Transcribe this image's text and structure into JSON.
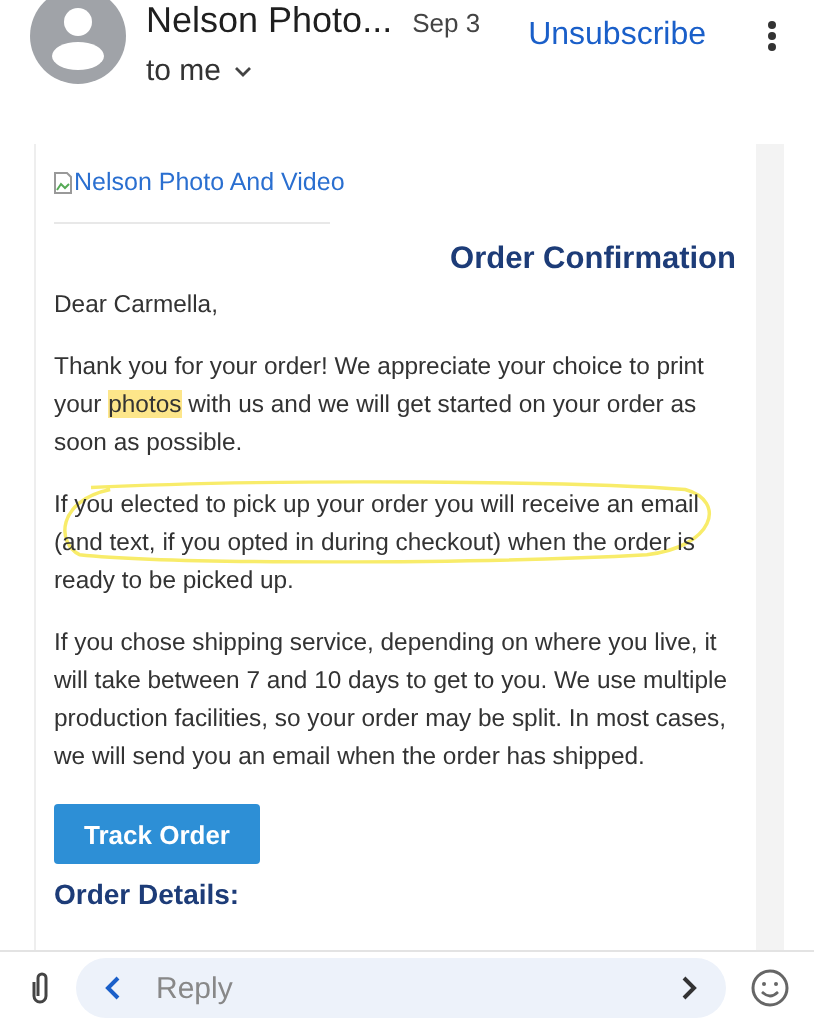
{
  "header": {
    "sender": "Nelson Photo...",
    "date": "Sep 3",
    "recipient": "to me",
    "unsubscribe": "Unsubscribe"
  },
  "email": {
    "logo_alt": "Nelson Photo And Video",
    "heading": "Order Confirmation",
    "greeting": "Dear Carmella,",
    "paragraphs": [
      {
        "parts": [
          {
            "text": "Thank you for your order! We appreciate your choice to print your ",
            "highlight": false
          },
          {
            "text": "photos",
            "highlight": true
          },
          {
            "text": " with us and we will get started on your order as soon as possible.",
            "highlight": false
          }
        ],
        "circled": false
      },
      {
        "parts": [
          {
            "text": "If you elected to pick up your order you will receive an email (and text, if you opted in during checkout) when the order is ready to be picked up.",
            "highlight": false
          }
        ],
        "circled": true
      },
      {
        "parts": [
          {
            "text": "If you chose shipping service, depending on where you live, it will take between 7 and 10 days to get to you. We use multiple production facilities, so your order may be split. In most cases, we will send you an email when the order has shipped.",
            "highlight": false
          }
        ],
        "circled": false
      }
    ],
    "button": "Track Order",
    "section": "Order Details:"
  },
  "reply_bar": {
    "placeholder": "Reply"
  }
}
